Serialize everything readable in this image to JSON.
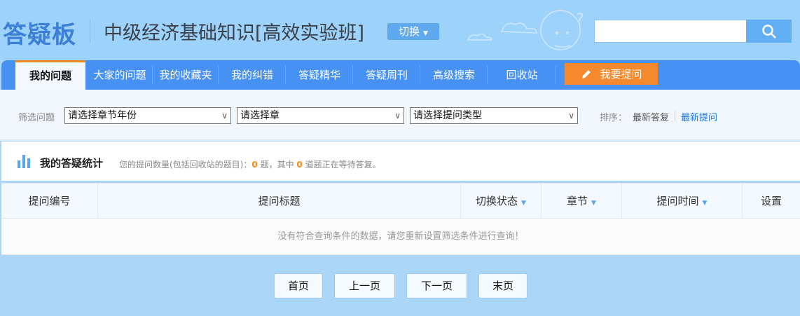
{
  "header": {
    "logo": "答疑板",
    "course_title": "中级经济基础知识[高效实验班]",
    "switch_label": "切换",
    "search_placeholder": ""
  },
  "nav": {
    "tabs": [
      {
        "label": "我的问题",
        "active": true
      },
      {
        "label": "大家的问题"
      },
      {
        "label": "我的收藏夹"
      },
      {
        "label": "我的纠错"
      },
      {
        "label": "答疑精华"
      },
      {
        "label": "答疑周刊"
      },
      {
        "label": "高级搜索"
      },
      {
        "label": "回收站"
      }
    ],
    "ask_label": "我要提问"
  },
  "filter": {
    "label": "筛选问题",
    "selects": [
      "请选择章节年份",
      "请选择章",
      "请选择提问类型"
    ],
    "sort_label": "排序：",
    "sort_options": [
      "最新答复",
      "最新提问"
    ],
    "sort_active": "最新提问"
  },
  "stats": {
    "title": "我的答疑统计",
    "desc_prefix": "您的提问数量(包括回收站的题目)：",
    "total": "0",
    "mid": "题，其中",
    "pending": "0",
    "suffix": "道题正在等待答复。"
  },
  "table": {
    "columns": [
      "提问编号",
      "提问标题",
      "切换状态",
      "章节",
      "提问时间",
      "设置"
    ],
    "empty_message": "没有符合查询条件的数据，请您重新设置筛选条件进行查询！"
  },
  "pagination": [
    "首页",
    "上一页",
    "下一页",
    "末页"
  ],
  "colors": {
    "nav": "#4791f2",
    "accent": "#f5892d",
    "link": "#1a73d6"
  }
}
